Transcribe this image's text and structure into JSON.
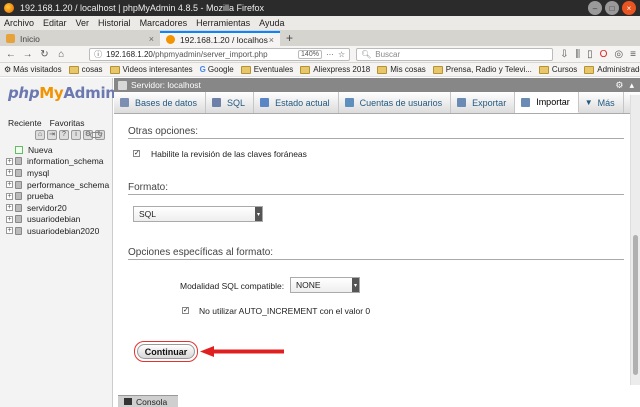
{
  "window": {
    "title": "192.168.1.20 / localhost | phpMyAdmin 4.8.5 - Mozilla Firefox"
  },
  "menubar": [
    "Archivo",
    "Editar",
    "Ver",
    "Historial",
    "Marcadores",
    "Herramientas",
    "Ayuda"
  ],
  "tabs": [
    {
      "label": "Inicio",
      "active": false
    },
    {
      "label": "192.168.1.20 / localhost",
      "active": true
    }
  ],
  "navbar": {
    "url_host": "192.168.1.20",
    "url_path": "/phpmyadmin/server_import.php",
    "zoom": "140%",
    "search_placeholder": "Buscar"
  },
  "bookmarks": [
    "Más visitados",
    "cosas",
    "Videos interesantes",
    "Google",
    "Eventuales",
    "Aliexpress 2018",
    "Mis cosas",
    "Prensa, Radio y Televi...",
    "Cursos",
    "Administrador"
  ],
  "sidebar": {
    "logo": {
      "php": "php",
      "my": "My",
      "admin": "Admin"
    },
    "links": [
      "Reciente",
      "Favoritas"
    ],
    "new_item": "Nueva",
    "databases": [
      "information_schema",
      "mysql",
      "performance_schema",
      "prueba",
      "servidor20",
      "usuariodebian",
      "usuariodebian2020"
    ]
  },
  "server_bar": {
    "label": "Servidor: localhost"
  },
  "pma_tabs": [
    {
      "label": "Bases de datos",
      "icon_color": "#7c8fb3"
    },
    {
      "label": "SQL",
      "icon_color": "#6e7fa8"
    },
    {
      "label": "Estado actual",
      "icon_color": "#5a86c5"
    },
    {
      "label": "Cuentas de usuarios",
      "icon_color": "#5f8fbf"
    },
    {
      "label": "Exportar",
      "icon_color": "#6b8bb7"
    },
    {
      "label": "Importar",
      "icon_color": "#6b8bb7"
    },
    {
      "label": "Más",
      "icon_color": "#235a81"
    }
  ],
  "content": {
    "other_options_title": "Otras opciones:",
    "foreign_keys_label": "Habilite la revisión de las claves foráneas",
    "format_title": "Formato:",
    "format_value": "SQL",
    "format_specific_title": "Opciones específicas al formato:",
    "sql_compat_label": "Modalidad SQL compatible:",
    "sql_compat_value": "NONE",
    "auto_increment_label": "No utilizar AUTO_INCREMENT con el valor 0",
    "submit_label": "Continuar"
  },
  "console": {
    "label": "Consola"
  },
  "colors": {
    "arrow": "#e02020",
    "server_bar": "#878787",
    "link": "#235a81"
  }
}
